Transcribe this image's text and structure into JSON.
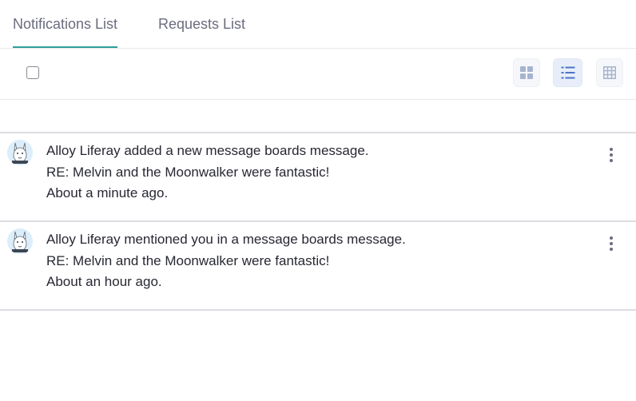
{
  "tabs": [
    {
      "label": "Notifications List",
      "active": true
    },
    {
      "label": "Requests List",
      "active": false
    }
  ],
  "toolbar": {
    "select_all_checked": false,
    "view_modes": [
      {
        "name": "cards",
        "icon": "cards-icon",
        "active": false
      },
      {
        "name": "list",
        "icon": "list-icon",
        "active": true
      },
      {
        "name": "table",
        "icon": "table-icon",
        "active": false
      }
    ]
  },
  "notifications": [
    {
      "title": "Alloy Liferay added a new message boards message.",
      "subject": "RE: Melvin and the Moonwalker were fantastic!",
      "time": "About a minute ago."
    },
    {
      "title": "Alloy Liferay mentioned you in a message boards message.",
      "subject": "RE: Melvin and the Moonwalker were fantastic!",
      "time": "About an hour ago."
    }
  ],
  "colors": {
    "accent": "#2e9e97",
    "text": "#272833",
    "muted": "#6b6c7e",
    "icon_blue": "#4b74c9",
    "icon_gray": "#a7b4cf"
  }
}
